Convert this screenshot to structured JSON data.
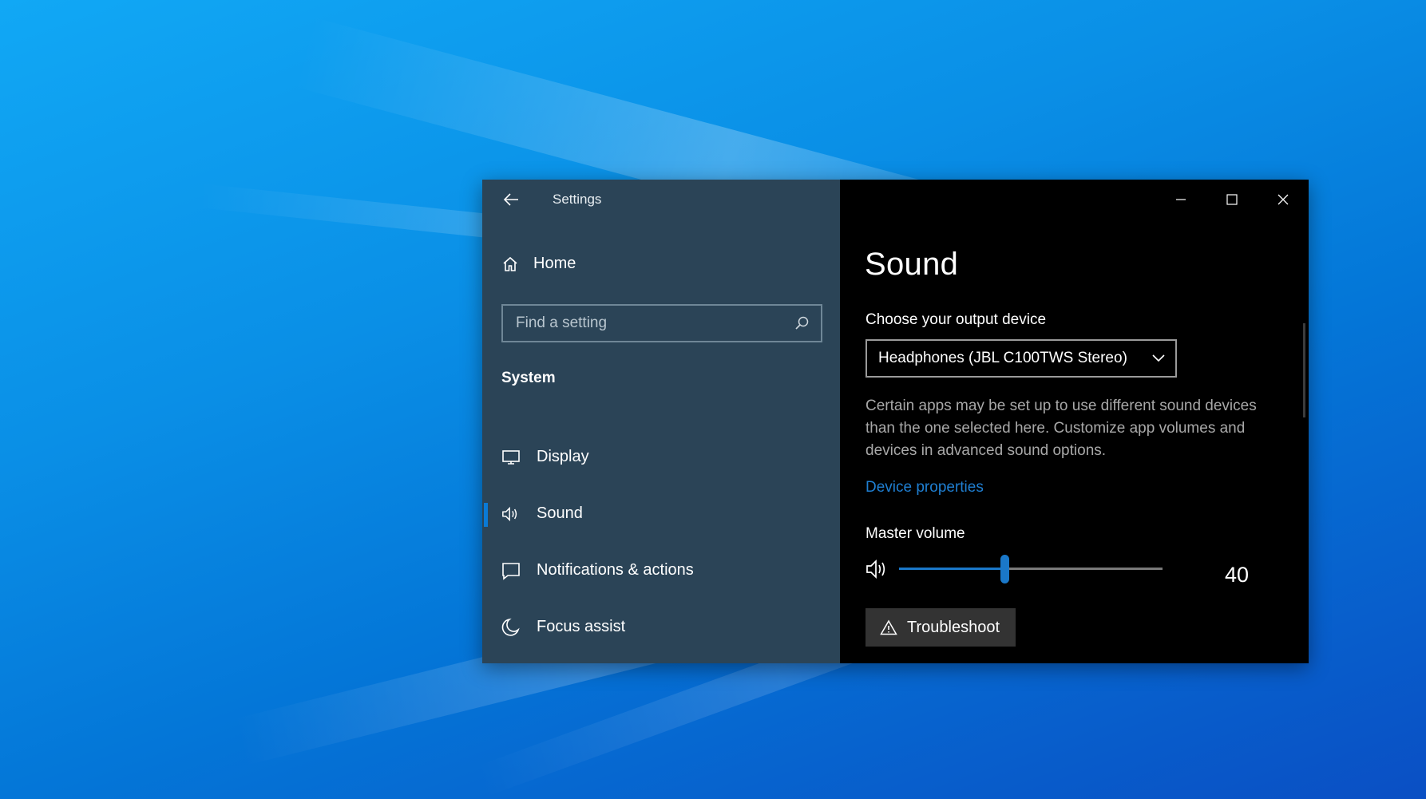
{
  "window": {
    "title": "Settings"
  },
  "sidebar": {
    "home_label": "Home",
    "search_placeholder": "Find a setting",
    "section_title": "System",
    "items": [
      {
        "label": "Display",
        "icon": "display-icon",
        "active": false
      },
      {
        "label": "Sound",
        "icon": "speaker-icon",
        "active": true
      },
      {
        "label": "Notifications & actions",
        "icon": "notifications-icon",
        "active": false
      },
      {
        "label": "Focus assist",
        "icon": "moon-icon",
        "active": false
      }
    ]
  },
  "main": {
    "title": "Sound",
    "output_label": "Choose your output device",
    "output_device": "Headphones (JBL C100TWS Stereo)",
    "description": "Certain apps may be set up to use different sound devices than the one selected here. Customize app volumes and devices in advanced sound options.",
    "device_properties_link": "Device properties",
    "master_volume_label": "Master volume",
    "volume_value": "40",
    "volume_fraction": 0.4,
    "troubleshoot_label": "Troubleshoot"
  },
  "colors": {
    "accent": "#1a78c9",
    "sidebar_bg": "#2b4457",
    "content_bg": "#000000"
  }
}
